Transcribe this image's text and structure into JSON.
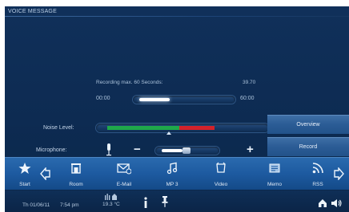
{
  "app": {
    "title": "VOICE MESSAGE"
  },
  "recording": {
    "label": "Recording max. 60 Seconds:",
    "remaining": "39.70",
    "start_time": "00:00",
    "end_time": "60:00",
    "progress_fraction": 0.34
  },
  "noise": {
    "label": "Noise Level:",
    "green_fraction": 0.5,
    "red_fraction": 0.25
  },
  "microphone": {
    "label": "Microphone:",
    "minus_label": "−",
    "plus_label": "+",
    "level_fraction": 0.4
  },
  "buttons": {
    "overview": "Overview",
    "record": "Record"
  },
  "nav": {
    "start": "Start",
    "room": "Room",
    "email": "E-Mail",
    "mp3": "MP 3",
    "video": "Video",
    "memo": "Memo",
    "rss": "RSS"
  },
  "status": {
    "date": "Th 01/06/11",
    "time": "7:54 pm",
    "temperature": "19.3 °C"
  },
  "colors": {
    "background": "#0d2b52",
    "nav_bar": "#1d5aa0",
    "noise_green": "#1fa84a",
    "noise_red": "#d3222a",
    "button": "#2c5d96"
  }
}
